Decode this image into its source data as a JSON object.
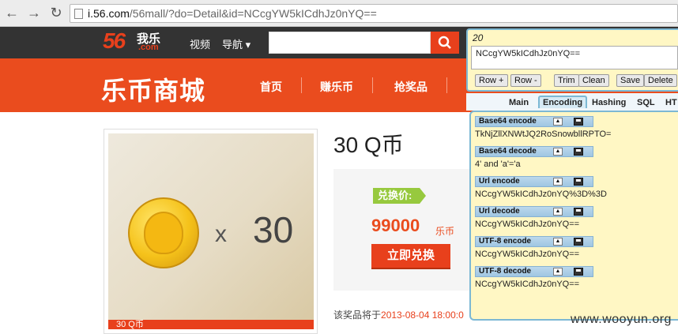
{
  "browser": {
    "back_icon": "back-arrow-icon",
    "forward_icon": "forward-arrow-icon",
    "reload_icon": "reload-icon",
    "url_host": "i.56.com",
    "url_path": "/56mall/?do=Detail&id=NCcgYW5kICdhJz0nYQ=="
  },
  "site": {
    "logo_num": "56",
    "logo_cn": "我乐",
    "logo_com": ".com",
    "top_links": [
      "视频",
      "导航 ▾"
    ],
    "search_placeholder": "",
    "mall_title": "乐币商城",
    "nav": [
      "首页",
      "赚乐币",
      "抢奖品"
    ]
  },
  "product": {
    "qty_mult": "x",
    "qty": "30",
    "name": "30 Q币",
    "price_tag": "兑换价:",
    "price": "99000",
    "price_unit": "乐币",
    "redeem": "立即兑换",
    "end_note_prefix": "该奖品将于",
    "end_note_date": "2013-08-04 18:00:0",
    "bottom_strip": "30 Q币"
  },
  "hackbar": {
    "count": "20",
    "text": "NCcgYW5kICdhJz0nYQ==",
    "buttons": [
      "Row +",
      "Row -",
      "Trim",
      "Clean",
      "Save",
      "Delete"
    ],
    "tabs": [
      "Main",
      "Encoding",
      "Hashing",
      "SQL",
      "HT"
    ],
    "active_tab": "Encoding",
    "rows": [
      {
        "label": "Base64 encode",
        "value": "TkNjZllXNWtJQ2RoSnowbllRPTO="
      },
      {
        "label": "Base64 decode",
        "value": "4' and 'a'='a"
      },
      {
        "label": "Url encode",
        "value": "NCcgYW5kICdhJz0nYQ%3D%3D"
      },
      {
        "label": "Url decode",
        "value": "NCcgYW5kICdhJz0nYQ=="
      },
      {
        "label": "UTF-8 encode",
        "value": "NCcgYW5kICdhJz0nYQ=="
      },
      {
        "label": "UTF-8 decode",
        "value": "NCcgYW5kICdhJz0nYQ=="
      }
    ]
  },
  "watermark": "www.wooyun.org",
  "colors": {
    "brand_orange": "#ea4c1e",
    "hackbar_blue": "#7cb8d4",
    "hackbar_bg": "#fff7c4"
  }
}
